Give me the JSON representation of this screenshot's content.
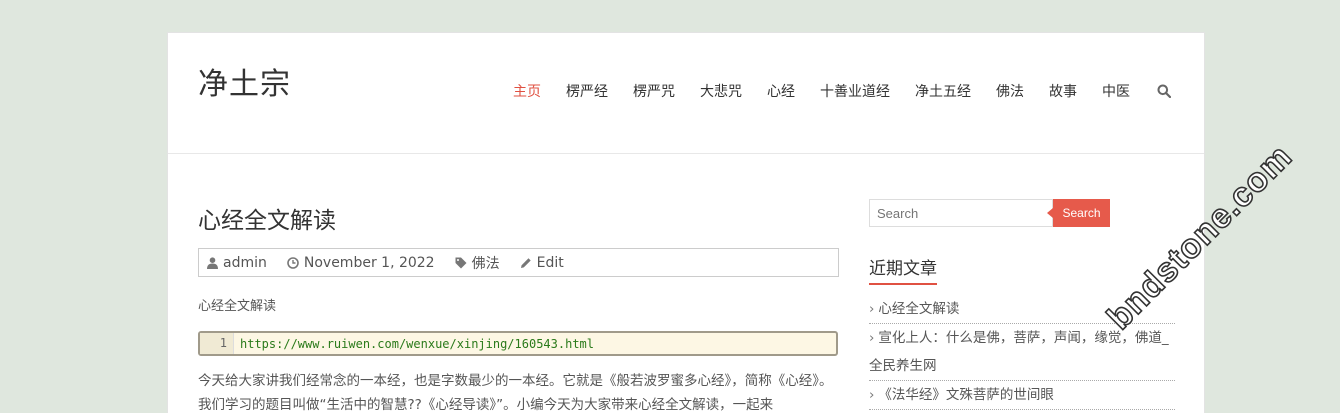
{
  "site": {
    "title": "净土宗"
  },
  "nav": {
    "items": [
      "主页",
      "楞严经",
      "楞严咒",
      "大悲咒",
      "心经",
      "十善业道经",
      "净土五经",
      "佛法",
      "故事",
      "中医"
    ],
    "active_index": 0
  },
  "post": {
    "title": "心经全文解读",
    "meta": {
      "author": "admin",
      "date": "November 1, 2022",
      "category": "佛法",
      "edit": "Edit"
    },
    "intro": "心经全文解读",
    "code": {
      "line_number": "1",
      "url": "https://www.ruiwen.com/wenxue/xinjing/160543.html"
    },
    "body": "今天给大家讲我们经常念的一本经，也是字数最少的一本经。它就是《般若波罗蜜多心经》，简称《心经》。我们学习的题目叫做“生活中的智慧??《心经导读》”。小编今天为大家带来心经全文解读，一起来"
  },
  "sidebar": {
    "search_placeholder": "Search",
    "search_button": "Search",
    "recent_title": "近期文章",
    "recent_posts": [
      "心经全文解读",
      "宣化上人：什么是佛，菩萨，声闻，缘觉，佛道_全民养生网",
      "《法华经》文殊菩萨的世间眼"
    ]
  },
  "watermark": "bndstone.com",
  "colors": {
    "accent": "#e05142",
    "background": "#dfe7de"
  }
}
